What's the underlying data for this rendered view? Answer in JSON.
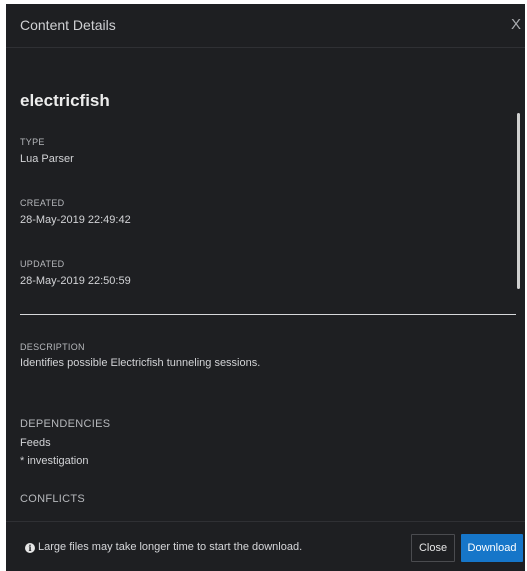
{
  "dialog": {
    "title": "Content Details",
    "close_icon": "X"
  },
  "content": {
    "name": "electricfish",
    "type_label": "TYPE",
    "type_value": "Lua Parser",
    "created_label": "CREATED",
    "created_value": "28-May-2019 22:49:42",
    "updated_label": "UPDATED",
    "updated_value": "28-May-2019 22:50:59",
    "description_label": "DESCRIPTION",
    "description_value": "Identifies possible Electricfish tunneling sessions.",
    "dependencies_label": "DEPENDENCIES",
    "dependencies_items": [
      "Feeds",
      "* investigation"
    ],
    "conflicts_label": "CONFLICTS"
  },
  "footer": {
    "info_icon": "info-circle-icon",
    "info_text": "Large files may take longer time to start the download.",
    "close_label": "Close",
    "download_label": "Download"
  },
  "colors": {
    "dialog_bg": "#1e1f22",
    "accent": "#1676c9",
    "text": "#d6d7da"
  }
}
